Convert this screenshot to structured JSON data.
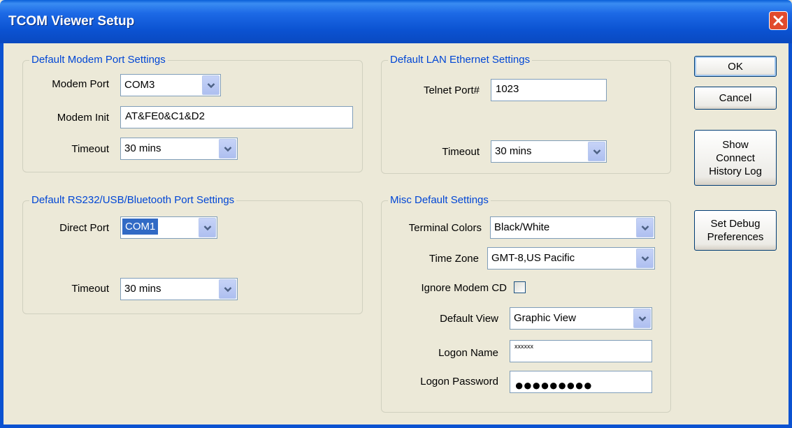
{
  "window": {
    "title": "TCOM Viewer Setup"
  },
  "buttons": {
    "ok": "OK",
    "cancel": "Cancel",
    "history": "Show Connect History Log",
    "debug": "Set Debug Preferences"
  },
  "modem": {
    "legend": "Default Modem Port Settings",
    "port_label": "Modem Port",
    "port_value": "COM3",
    "init_label": "Modem Init",
    "init_value": "AT&FE0&C1&D2",
    "timeout_label": "Timeout",
    "timeout_value": "30 mins"
  },
  "direct": {
    "legend": "Default RS232/USB/Bluetooth Port Settings",
    "port_label": "Direct Port",
    "port_value": "COM1",
    "timeout_label": "Timeout",
    "timeout_value": "30 mins"
  },
  "lan": {
    "legend": "Default LAN Ethernet Settings",
    "telnet_label": "Telnet Port#",
    "telnet_value": "1023",
    "timeout_label": "Timeout",
    "timeout_value": "30 mins"
  },
  "misc": {
    "legend": "Misc Default Settings",
    "colors_label": "Terminal Colors",
    "colors_value": "Black/White",
    "tz_label": "Time Zone",
    "tz_value": "GMT-8,US Pacific",
    "cd_label": "Ignore Modem CD",
    "cd_checked": false,
    "view_label": "Default View",
    "view_value": "Graphic View",
    "logon_label": "Logon Name",
    "logon_value": "xxxxxx",
    "password_label": "Logon Password",
    "password_mask": "●●●●●●●●●"
  },
  "icons": {
    "close": "close-icon",
    "dropdown": "chevron-down-icon"
  },
  "colors": {
    "titlebar": "#0b52d1",
    "legend": "#0046d5",
    "selection": "#316ac5",
    "close": "#e14b2d",
    "dialog": "#ece9d8"
  }
}
